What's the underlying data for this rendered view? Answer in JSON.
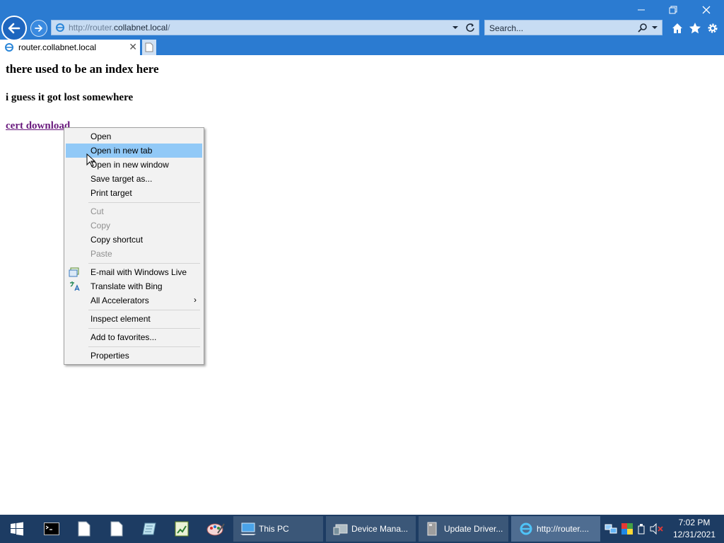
{
  "browser": {
    "address_host_prefix": "http://router.",
    "address_host_domain": "collabnet.local",
    "address_host_suffix": "/",
    "search_placeholder": "Search...",
    "tab_title": "router.collabnet.local"
  },
  "page": {
    "heading": "there used to be an index here",
    "subheading": "i guess it got lost somewhere",
    "link_text": "cert download"
  },
  "context_menu": {
    "items": [
      {
        "label": "Open"
      },
      {
        "label": "Open in new tab"
      },
      {
        "label": "Open in new window"
      },
      {
        "label": "Save target as..."
      },
      {
        "label": "Print target"
      },
      {
        "label": "Cut"
      },
      {
        "label": "Copy"
      },
      {
        "label": "Copy shortcut"
      },
      {
        "label": "Paste"
      },
      {
        "label": "E-mail with Windows Live"
      },
      {
        "label": "Translate with Bing"
      },
      {
        "label": "All Accelerators"
      },
      {
        "label": "Inspect element"
      },
      {
        "label": "Add to favorites..."
      },
      {
        "label": "Properties"
      }
    ]
  },
  "taskbar": {
    "tasks": [
      {
        "label": "This PC"
      },
      {
        "label": "Device Mana..."
      },
      {
        "label": "Update Driver..."
      },
      {
        "label": "http://router...."
      }
    ],
    "clock_time": "7:02 PM",
    "clock_date": "12/31/2021"
  },
  "colors": {
    "chrome": "#2b7bd1",
    "taskbar": "#1d3c63",
    "menu_highlight": "#91c9f7",
    "link": "#6a1b7e"
  }
}
